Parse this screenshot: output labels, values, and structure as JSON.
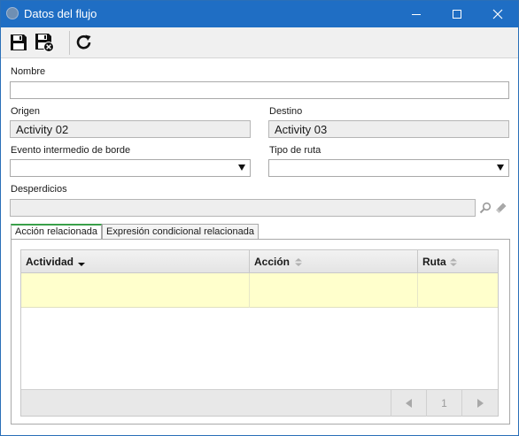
{
  "window": {
    "title": "Datos del flujo",
    "accent_color": "#1f6ec4"
  },
  "toolbar": {
    "buttons": [
      "save-icon",
      "save-and-close-icon",
      "refresh-icon"
    ]
  },
  "form": {
    "nombre": {
      "label": "Nombre",
      "value": ""
    },
    "origen": {
      "label": "Origen",
      "value": "Activity 02"
    },
    "destino": {
      "label": "Destino",
      "value": "Activity 03"
    },
    "evento": {
      "label": "Evento intermedio de borde",
      "value": ""
    },
    "tipo_ruta": {
      "label": "Tipo de ruta",
      "value": ""
    },
    "desperdicios": {
      "label": "Desperdicios",
      "value": ""
    }
  },
  "tabs": [
    {
      "label": "Acción relacionada",
      "active": true
    },
    {
      "label": "Expresión condicional relacionada",
      "active": false
    }
  ],
  "grid": {
    "columns": [
      "Actividad",
      "Acción",
      "Ruta"
    ],
    "rows": [
      [
        "",
        "",
        ""
      ]
    ],
    "selected_row_color": "#ffffcc",
    "pager": {
      "page": "1"
    }
  }
}
